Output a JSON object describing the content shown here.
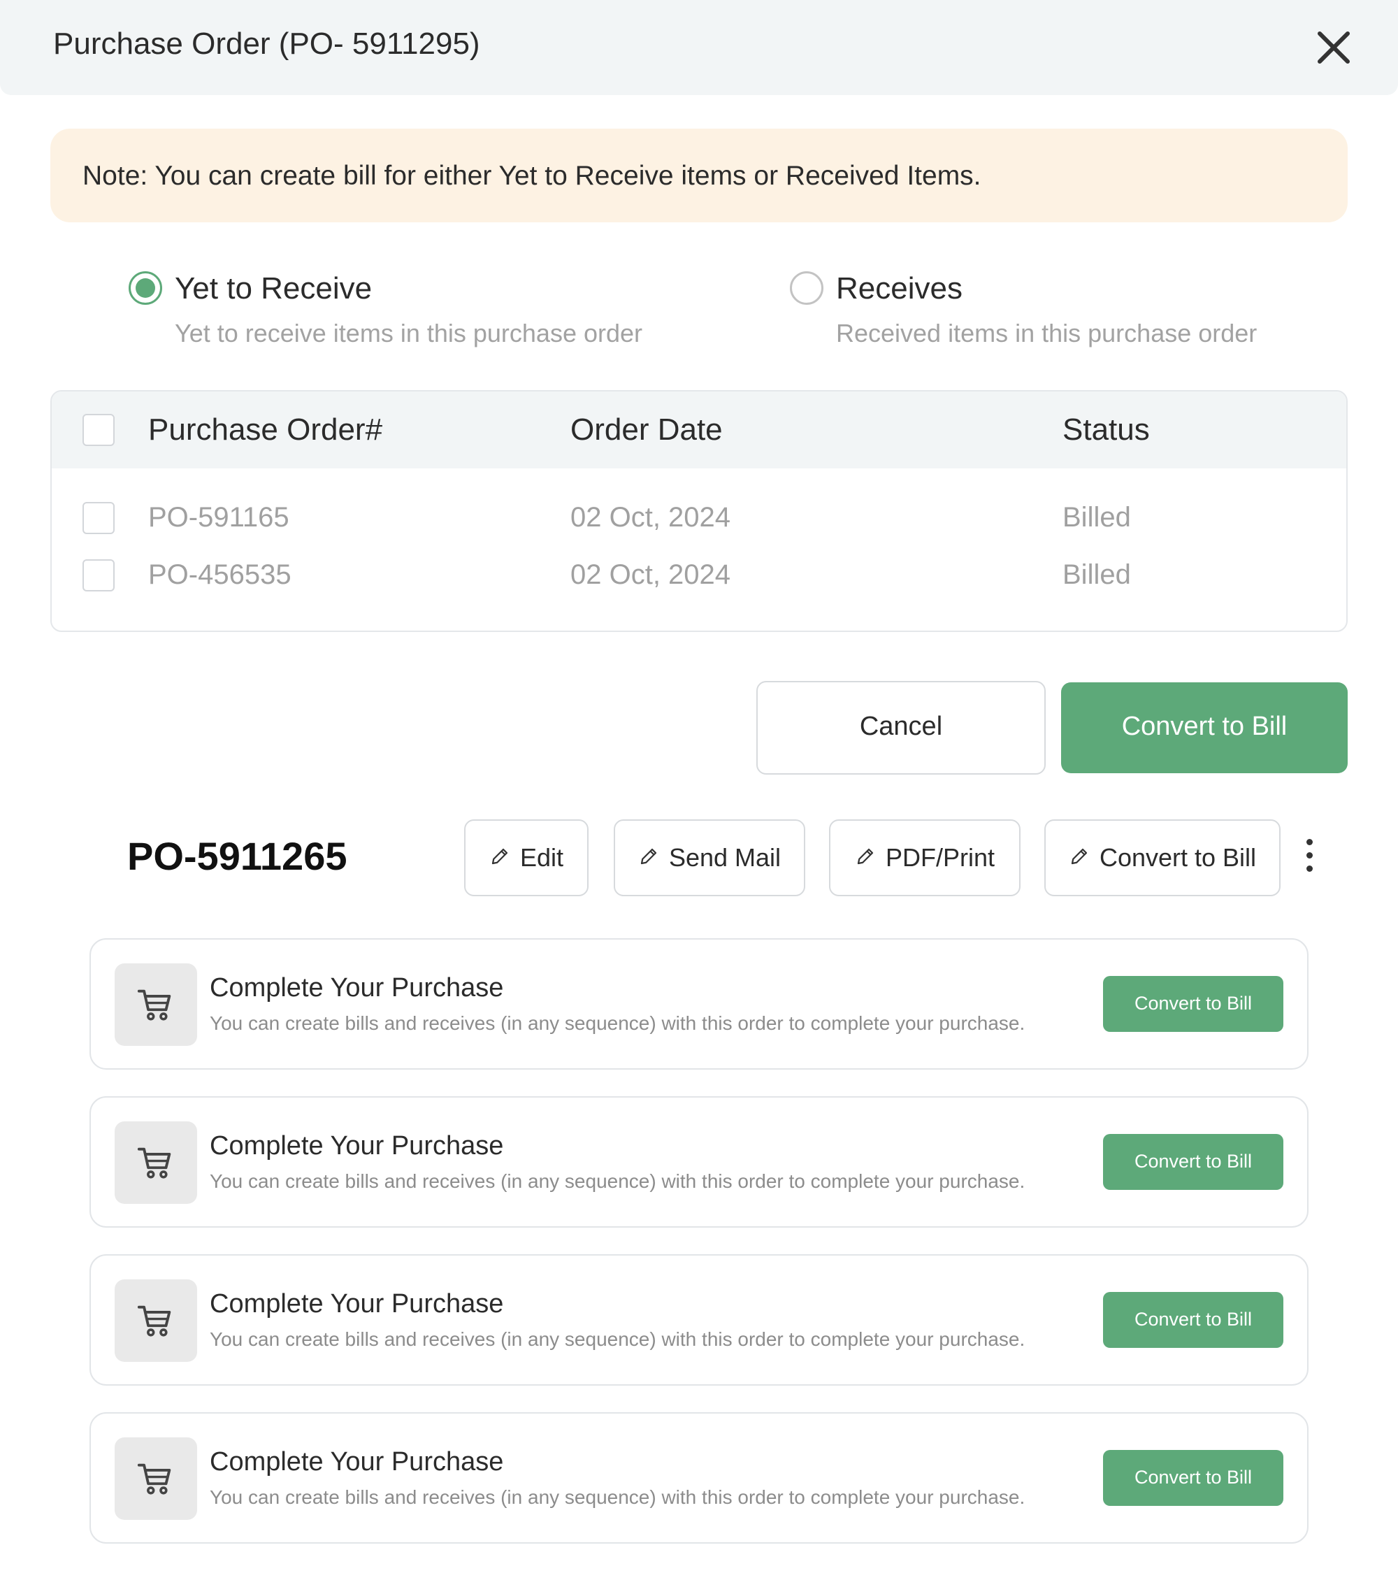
{
  "modal": {
    "title": "Purchase Order (PO- 5911295)",
    "close_icon": "close-icon"
  },
  "note": {
    "text": "Note: You can create bill for either Yet to Receive items or Received Items."
  },
  "options": [
    {
      "label": "Yet to Receive",
      "description": "Yet to receive items in this purchase order",
      "selected": true
    },
    {
      "label": "Receives",
      "description": "Received items in this purchase order",
      "selected": false
    }
  ],
  "table": {
    "headers": [
      "Purchase Order#",
      "Order Date",
      "Status"
    ],
    "rows": [
      {
        "po": "PO-591165",
        "date": "02 Oct, 2024",
        "status": "Billed"
      },
      {
        "po": "PO-456535",
        "date": "02 Oct, 2024",
        "status": "Billed"
      }
    ]
  },
  "actions": {
    "cancel_label": "Cancel",
    "convert_label": "Convert to Bill"
  },
  "po_panel": {
    "id": "PO-5911265",
    "tools": [
      {
        "label": "Edit",
        "icon": "pencil-icon"
      },
      {
        "label": "Send Mail",
        "icon": "pencil-icon"
      },
      {
        "label": "PDF/Print",
        "icon": "pencil-icon"
      },
      {
        "label": "Convert to Bill",
        "icon": "pencil-icon"
      }
    ],
    "more_icon": "kebab-menu-icon"
  },
  "cards": [
    {
      "title": "Complete Your Purchase",
      "description": "You can create bills and receives (in any sequence) with this order to complete your purchase.",
      "button": "Convert to Bill",
      "icon": "cart-icon"
    },
    {
      "title": "Complete Your Purchase",
      "description": "You can create bills and receives (in any sequence) with this order to complete your purchase.",
      "button": "Convert to Bill",
      "icon": "cart-icon"
    },
    {
      "title": "Complete Your Purchase",
      "description": "You can create bills and receives (in any sequence) with this order to complete your purchase.",
      "button": "Convert to Bill",
      "icon": "cart-icon"
    },
    {
      "title": "Complete Your Purchase",
      "description": "You can create bills and receives (in any sequence) with this order to complete your purchase.",
      "button": "Convert to Bill",
      "icon": "cart-icon"
    }
  ],
  "colors": {
    "accent_green": "#5da979",
    "header_bg": "#f2f5f6",
    "note_bg": "#fdf2e3"
  }
}
